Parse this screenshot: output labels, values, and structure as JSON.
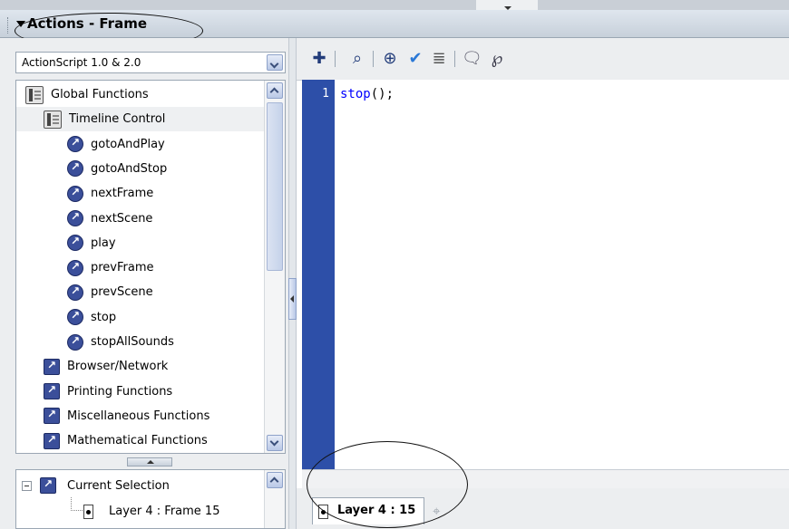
{
  "panel": {
    "title": "Actions - Frame"
  },
  "language_select": {
    "value": "ActionScript 1.0 & 2.0"
  },
  "toolbox": {
    "items": [
      {
        "label": "Global Functions",
        "icon": "book-icon",
        "indent": 0
      },
      {
        "label": "Timeline Control",
        "icon": "book-icon",
        "indent": 1
      },
      {
        "label": "gotoAndPlay",
        "icon": "action-icon",
        "indent": 2
      },
      {
        "label": "gotoAndStop",
        "icon": "action-icon",
        "indent": 2
      },
      {
        "label": "nextFrame",
        "icon": "action-icon",
        "indent": 2
      },
      {
        "label": "nextScene",
        "icon": "action-icon",
        "indent": 2
      },
      {
        "label": "play",
        "icon": "action-icon",
        "indent": 2
      },
      {
        "label": "prevFrame",
        "icon": "action-icon",
        "indent": 2
      },
      {
        "label": "prevScene",
        "icon": "action-icon",
        "indent": 2
      },
      {
        "label": "stop",
        "icon": "action-icon",
        "indent": 2
      },
      {
        "label": "stopAllSounds",
        "icon": "action-icon",
        "indent": 2
      },
      {
        "label": "Browser/Network",
        "icon": "category-icon",
        "indent": 1
      },
      {
        "label": "Printing Functions",
        "icon": "category-icon",
        "indent": 1
      },
      {
        "label": "Miscellaneous Functions",
        "icon": "category-icon",
        "indent": 1
      },
      {
        "label": "Mathematical Functions",
        "icon": "category-icon",
        "indent": 1
      }
    ]
  },
  "selection_tree": {
    "root": "Current Selection",
    "child": "Layer 4 : Frame 15"
  },
  "toolbar": {
    "icons": [
      "add-statement-icon",
      "find-icon",
      "insert-target-path-icon",
      "check-syntax-icon",
      "auto-format-icon",
      "code-hint-icon",
      "debug-options-icon"
    ]
  },
  "editor": {
    "line_number": "1",
    "code_keyword": "stop",
    "code_rest": "();"
  },
  "layer_tab": {
    "label": "Layer 4 : 15"
  },
  "colors": {
    "gutter": "#2d4fa8",
    "keyword": "#0000ff",
    "panel": "#eceef0"
  }
}
